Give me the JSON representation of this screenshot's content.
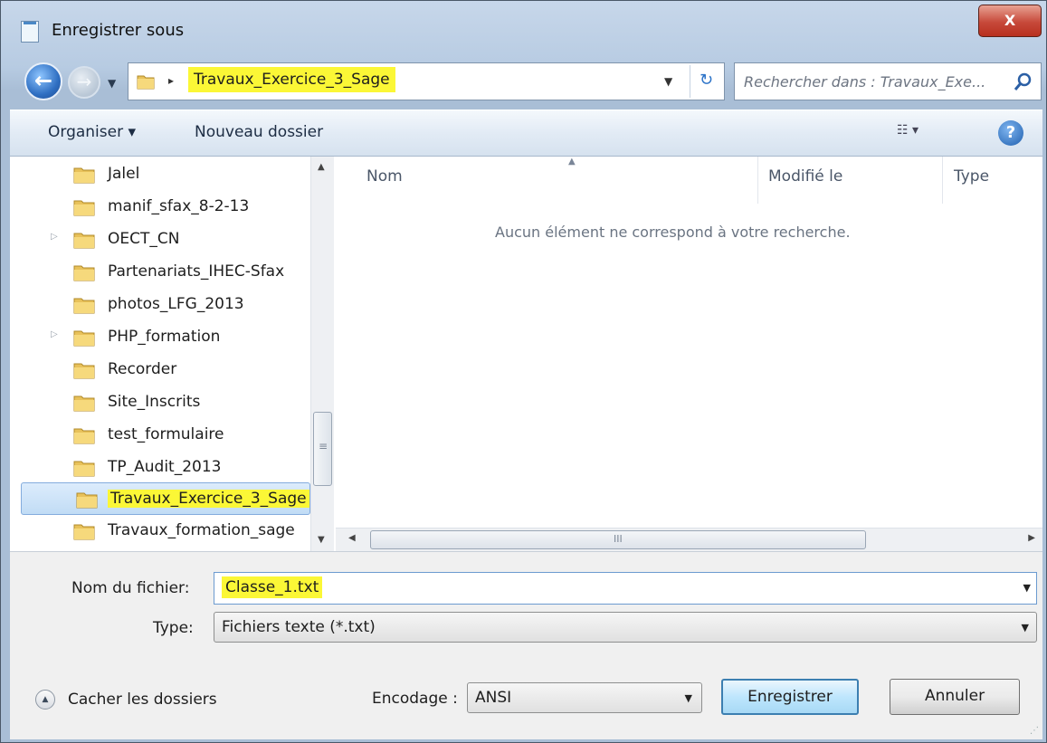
{
  "window": {
    "title": "Enregistrer sous",
    "close_glyph": "X"
  },
  "nav": {
    "back_glyph": "←",
    "forward_glyph": "→",
    "address": {
      "crumb_chevron": "▸",
      "path": "Travaux_Exercice_3_Sage",
      "dropdown_glyph": "▼",
      "refresh_glyph": "↻"
    },
    "search": {
      "placeholder": "Rechercher dans : Travaux_Exe..."
    }
  },
  "toolbar": {
    "organize_label": "Organiser ▾",
    "new_folder_label": "Nouveau dossier",
    "views_glyph": "☷ ▾",
    "help_glyph": "?"
  },
  "tree": {
    "items": [
      {
        "label": "Jalel",
        "expander": ""
      },
      {
        "label": "manif_sfax_8-2-13",
        "expander": ""
      },
      {
        "label": "OECT_CN",
        "expander": "▷"
      },
      {
        "label": "Partenariats_IHEC-Sfax",
        "expander": ""
      },
      {
        "label": "photos_LFG_2013",
        "expander": ""
      },
      {
        "label": "PHP_formation",
        "expander": "▷"
      },
      {
        "label": "Recorder",
        "expander": ""
      },
      {
        "label": "Site_Inscrits",
        "expander": ""
      },
      {
        "label": "test_formulaire",
        "expander": ""
      },
      {
        "label": "TP_Audit_2013",
        "expander": ""
      },
      {
        "label": "Travaux_Exercice_3_Sage",
        "expander": "",
        "selected": true
      },
      {
        "label": "Travaux_formation_sage",
        "expander": ""
      }
    ]
  },
  "filelist": {
    "columns": [
      "Nom",
      "Modifié le",
      "Type"
    ],
    "empty_message": "Aucun élément ne correspond à votre recherche."
  },
  "form": {
    "filename_label": "Nom du fichier:",
    "filename_value": "Classe_1.txt",
    "type_label": "Type:",
    "type_value": "Fichiers texte (*.txt)",
    "encoding_label": "Encodage :",
    "encoding_value": "ANSI",
    "hide_folders_label": "Cacher les dossiers",
    "save_label": "Enregistrer",
    "cancel_label": "Annuler"
  },
  "colors": {
    "highlight": "#fbf736",
    "selection": "#c1dcf5",
    "chrome": "#a9bed6"
  },
  "icons": [
    "folder-icon",
    "search-icon",
    "help-icon",
    "views-icon",
    "refresh-icon",
    "back-arrow-icon",
    "forward-arrow-icon",
    "close-icon"
  ]
}
